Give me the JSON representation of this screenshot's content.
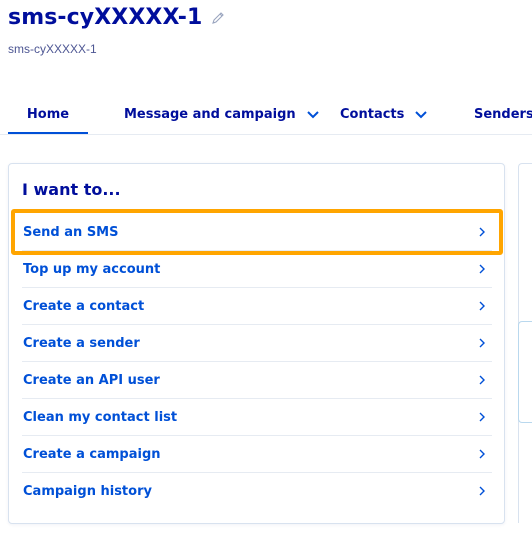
{
  "header": {
    "title": "sms-cyXXXXX-1",
    "subtitle": "sms-cyXXXXX-1",
    "edit_icon": "pencil-icon"
  },
  "tabs": [
    {
      "label": "Home",
      "active": true
    },
    {
      "label": "Message and campaign",
      "dropdown": true
    },
    {
      "label": "Contacts",
      "dropdown": true
    },
    {
      "label": "Senders"
    }
  ],
  "card": {
    "heading": "I want to...",
    "items": [
      {
        "label": "Send an SMS",
        "highlighted": true
      },
      {
        "label": "Top up my account"
      },
      {
        "label": "Create a contact"
      },
      {
        "label": "Create a sender"
      },
      {
        "label": "Create an API user"
      },
      {
        "label": "Clean my contact list"
      },
      {
        "label": "Create a campaign"
      },
      {
        "label": "Campaign history"
      }
    ]
  },
  "colors": {
    "title": "#000e9c",
    "link": "#0050d7",
    "highlight": "#ffa500",
    "border": "#d8e2ef"
  }
}
